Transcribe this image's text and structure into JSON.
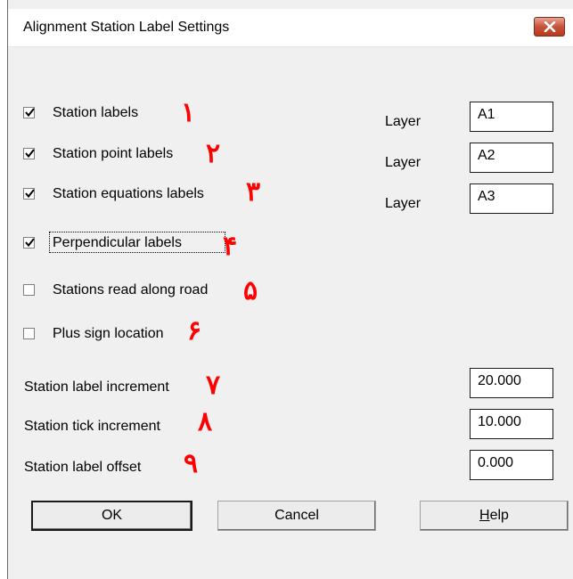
{
  "dialog": {
    "title": "Alignment Station Label Settings"
  },
  "checkboxes": [
    {
      "label": "Station labels",
      "checked": true,
      "marker": "١"
    },
    {
      "label": "Station point labels",
      "checked": true,
      "marker": "٢"
    },
    {
      "label": "Station equations labels",
      "checked": true,
      "marker": "٣"
    },
    {
      "label": "Perpendicular labels",
      "checked": true,
      "marker": "۴"
    },
    {
      "label": "Stations read along road",
      "checked": false,
      "marker": "۵"
    },
    {
      "label": "Plus sign location",
      "checked": false,
      "marker": "۶"
    }
  ],
  "layers": [
    {
      "label": "Layer",
      "value": "A1"
    },
    {
      "label": "Layer",
      "value": "A2"
    },
    {
      "label": "Layer",
      "value": "A3"
    }
  ],
  "increments": [
    {
      "label": "Station label increment",
      "value": "20.000",
      "marker": "٧"
    },
    {
      "label": "Station tick increment",
      "value": "10.000",
      "marker": "٨"
    },
    {
      "label": "Station label offset",
      "value": "0.000",
      "marker": "٩"
    }
  ],
  "buttons": {
    "ok": "OK",
    "cancel": "Cancel",
    "help": "Help"
  }
}
